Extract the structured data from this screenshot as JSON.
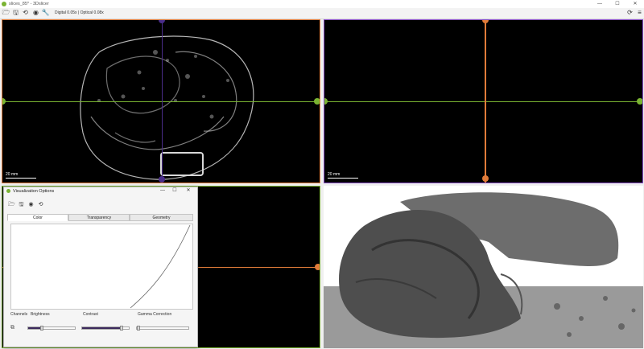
{
  "window": {
    "title": "slices_85* - 3Dslicer",
    "controls": {
      "minimize": "—",
      "maximize": "☐",
      "close": "✕"
    }
  },
  "toolbar": {
    "icons": [
      "open-folder-icon",
      "save-icon",
      "history-icon",
      "eye-icon",
      "wrench-icon"
    ],
    "zoom_status": "Digital 0.05x | Optical 0.08x",
    "right_icons": [
      "refresh-icon",
      "menu-icon"
    ]
  },
  "viewports": {
    "axial": {
      "scale_label": "20 mm",
      "border_color": "#e07b39"
    },
    "sagittal": {
      "scale_label": "20 mm",
      "border_color": "#8a50c8"
    },
    "coronal": {
      "border_color": "#7ab332"
    },
    "render3d": {
      "background": "#ffffff"
    }
  },
  "crosshair_colors": {
    "green": "#7ab332",
    "orange": "#e07b39",
    "purple": "#4a2d8a"
  },
  "visualization_options": {
    "title": "Visualization Options",
    "controls": {
      "minimize": "—",
      "maximize": "☐",
      "close": "✕"
    },
    "tool_icons": [
      "folder-icon",
      "save-icon",
      "camera-icon",
      "reset-icon"
    ],
    "tabs": [
      "Color",
      "Transparency",
      "Geometry"
    ],
    "active_tab": "Color",
    "labels": {
      "channels": "Channels",
      "brightness": "Brightness",
      "contrast": "Contrast",
      "gamma": "Gamma Correction"
    },
    "sliders": {
      "brightness": 0.3,
      "contrast": 0.85,
      "gamma": 0.0
    }
  }
}
